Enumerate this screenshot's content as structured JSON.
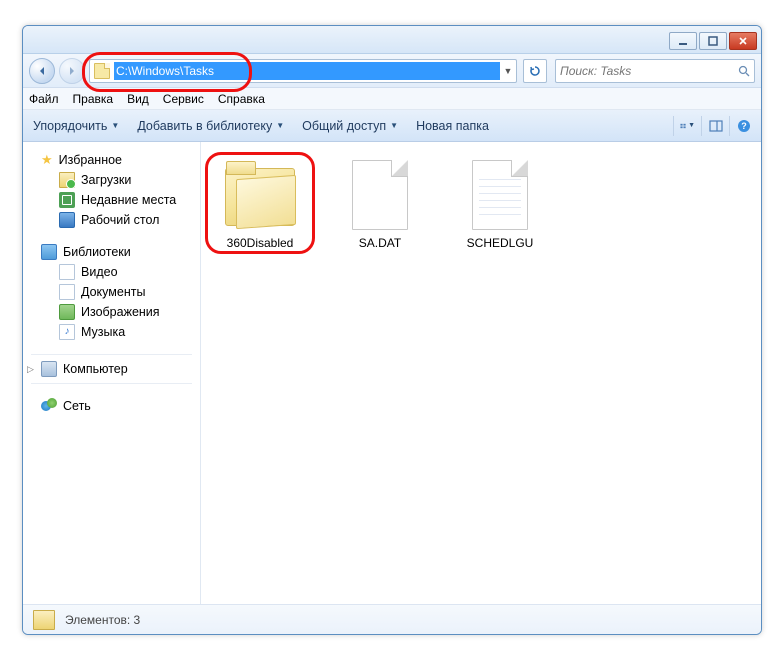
{
  "address_path": "C:\\Windows\\Tasks",
  "search_placeholder": "Поиск: Tasks",
  "menu": {
    "file": "Файл",
    "edit": "Правка",
    "view": "Вид",
    "tools": "Сервис",
    "help": "Справка"
  },
  "toolbar": {
    "organize": "Упорядочить",
    "addlib": "Добавить в библиотеку",
    "share": "Общий доступ",
    "newfolder": "Новая папка"
  },
  "sidebar": {
    "favorites": {
      "title": "Избранное",
      "items": [
        "Загрузки",
        "Недавние места",
        "Рабочий стол"
      ]
    },
    "libraries": {
      "title": "Библиотеки",
      "items": [
        "Видео",
        "Документы",
        "Изображения",
        "Музыка"
      ]
    },
    "computer": "Компьютер",
    "network": "Сеть"
  },
  "items": [
    {
      "name": "360Disabled",
      "type": "folder"
    },
    {
      "name": "SA.DAT",
      "type": "file"
    },
    {
      "name": "SCHEDLGU",
      "type": "file-lined"
    }
  ],
  "status_text": "Элементов: 3"
}
